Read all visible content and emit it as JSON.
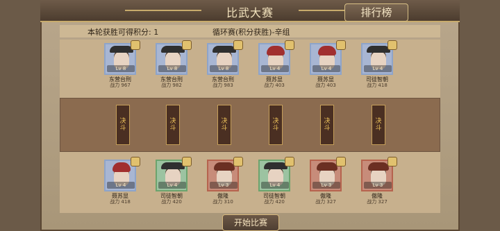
{
  "header": {
    "title": "比武大赛",
    "rank_button": "排行榜"
  },
  "info": {
    "left": "本轮获胜可得积分: 1",
    "mid": "循环赛(积分获胜)-辛组"
  },
  "top_cards": [
    {
      "name": "东营台刑",
      "power": "战力 967",
      "badge": "Lv 8",
      "type": "hat",
      "frame": "blue"
    },
    {
      "name": "东营台刑",
      "power": "战力 982",
      "badge": "Lv 8",
      "type": "hat",
      "frame": "blue"
    },
    {
      "name": "东营台刑",
      "power": "战力 983",
      "badge": "Lv 8",
      "type": "hat",
      "frame": "blue"
    },
    {
      "name": "聂苏显",
      "power": "战力 403",
      "badge": "Lv 4",
      "type": "hood",
      "frame": "blue"
    },
    {
      "name": "聂苏显",
      "power": "战力 403",
      "badge": "Lv 4",
      "type": "hood",
      "frame": "blue"
    },
    {
      "name": "司徒智朝",
      "power": "战力 418",
      "badge": "Lv 4",
      "type": "hat",
      "frame": "blue"
    }
  ],
  "banners": [
    "决斗",
    "决斗",
    "决斗",
    "决斗",
    "决斗",
    "决斗"
  ],
  "bottom_cards": [
    {
      "name": "聂苏显",
      "power": "战力 418",
      "badge": "Lv 4",
      "type": "hood",
      "frame": "blue"
    },
    {
      "name": "司徒智朝",
      "power": "战力 420",
      "badge": "Lv 4",
      "type": "hat",
      "frame": "green"
    },
    {
      "name": "傲隆",
      "power": "战力 310",
      "badge": "Lv 3",
      "type": "helmet",
      "frame": "red"
    },
    {
      "name": "司徒智朝",
      "power": "战力 420",
      "badge": "Lv 4",
      "type": "hat",
      "frame": "green"
    },
    {
      "name": "傲隆",
      "power": "战力 327",
      "badge": "Lv 3",
      "type": "helmet",
      "frame": "red"
    },
    {
      "name": "傲隆",
      "power": "战力 327",
      "badge": "Lv 3",
      "type": "helmet",
      "frame": "red"
    }
  ],
  "footer": {
    "start_button": "开始比赛"
  }
}
